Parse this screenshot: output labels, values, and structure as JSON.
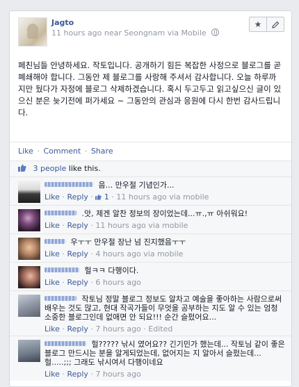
{
  "post": {
    "author": "Jagto",
    "time": "11 hours ago",
    "location": "near Seongnam",
    "via": "via Mobile",
    "text": "페친님들 안녕하세요. 작토입니다. 공개하기 힘든 복잡한 사정으로 블로그를 곧 폐쇄해야 합니다. 그동안 제 블로그를 사랑해 주셔서 감사합니다. 오늘 하루까지만 뒀다가 자정에 블로그 삭제하겠습니다. 혹시 두고두고 읽고싶으신 글이 있으신 분은 늦기전에 퍼가세요 ~ 그동안의 관심과 응원에 다시 한번 감사드립니다."
  },
  "actions": {
    "like": "Like",
    "comment": "Comment",
    "share": "Share",
    "separator": "·"
  },
  "likes": {
    "count_link": "3 people",
    "suffix": "like this."
  },
  "comments": [
    {
      "text": "음... 만우절 기념인가...",
      "like_count": "1",
      "time": "11 hours ago",
      "via": "via mobile",
      "edited": ""
    },
    {
      "text": ".앗, 제겐 알찬 정보의 장이었는데...ㅠ.,ㅠ 아쉬워요!",
      "like_count": "",
      "time": "11 hours ago",
      "via": "via mobile",
      "edited": ""
    },
    {
      "text": "우ㅜㅜ 만우절 장난 넘 진지했음ㅜㅜ",
      "like_count": "",
      "time": "4 hours ago",
      "via": "via mobile",
      "edited": ""
    },
    {
      "text": "헐ㅋㅋ 다행이다.",
      "like_count": "",
      "time": "6 hours ago",
      "via": "",
      "edited": ""
    },
    {
      "text": "작토님 정말 블로그 정보도 알차고 예술을 좋아하는 사람으로써 배우는 것도 많고, 현대 작곡가들이 무엇을 공부하는 지도 알 수 있는 엄청 소중한 블로그인데 없애면 안 되요!!! 순간 슬펐어요...",
      "like_count": "",
      "time": "7 hours ago",
      "via": "",
      "edited": "Edited"
    },
    {
      "text": "헐????? 낚시 였어요?? 긴기민가 했는데... 작토님 같이 좋은 블로그 만드시는 분을 알게되었는데, 없어지는 지 알아서 슬펐는데... 헐.....;;; 그래도 낚시여서 다행이네요",
      "like_count": "",
      "time": "7 hours ago",
      "via": "",
      "edited": ""
    }
  ],
  "comment_actions": {
    "like": "Like",
    "reply": "Reply"
  },
  "colors": {
    "link": "#3b5998",
    "meta": "#9197a3",
    "background": "#e9ebee"
  },
  "icons": [
    "star-icon",
    "pencil-icon",
    "globe-icon",
    "thumbs-up-icon"
  ]
}
